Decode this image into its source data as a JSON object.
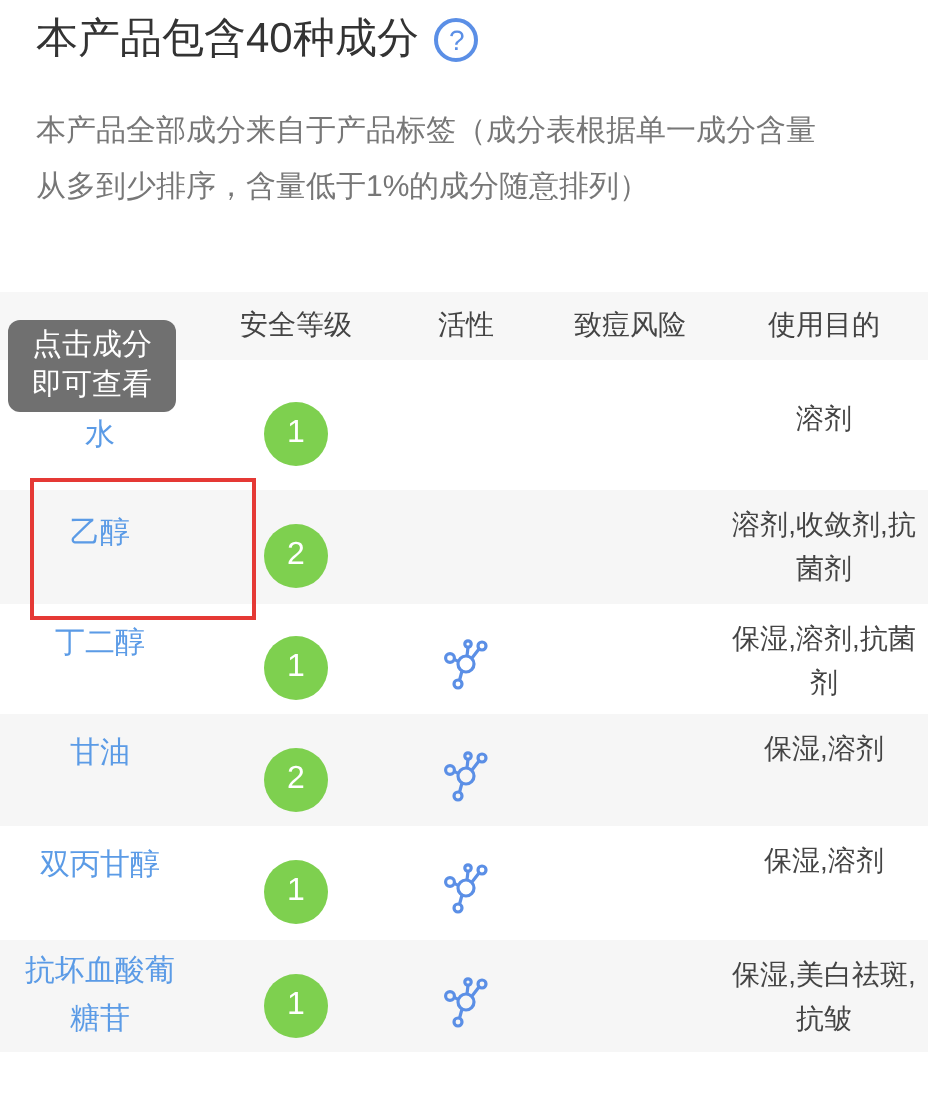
{
  "title": "本产品包含40种成分",
  "help": "?",
  "description": "本产品全部成分来自于产品标签（成分表根据单一成分含量从多到少排序，含量低于1%的成分随意排列）",
  "table": {
    "columns": [
      "安全等级",
      "活性",
      "致痘风险",
      "使用目的"
    ],
    "rows": [
      {
        "name": "水",
        "safety": "1",
        "active": false,
        "purpose": "溶剂",
        "highlighted": false
      },
      {
        "name": "乙醇",
        "safety": "2",
        "active": false,
        "purpose": "溶剂,收敛剂,抗菌剂",
        "highlighted": true
      },
      {
        "name": "丁二醇",
        "safety": "1",
        "active": true,
        "purpose": "保湿,溶剂,抗菌剂",
        "highlighted": false
      },
      {
        "name": "甘油",
        "safety": "2",
        "active": true,
        "purpose": "保湿,溶剂",
        "highlighted": false
      },
      {
        "name": "双丙甘醇",
        "safety": "1",
        "active": true,
        "purpose": "保湿,溶剂",
        "highlighted": false
      },
      {
        "name": "抗坏血酸葡糖苷",
        "safety": "1",
        "active": true,
        "purpose": "保湿,美白祛斑,抗皱",
        "highlighted": false
      }
    ]
  },
  "tooltip": "点击成分即可查看"
}
